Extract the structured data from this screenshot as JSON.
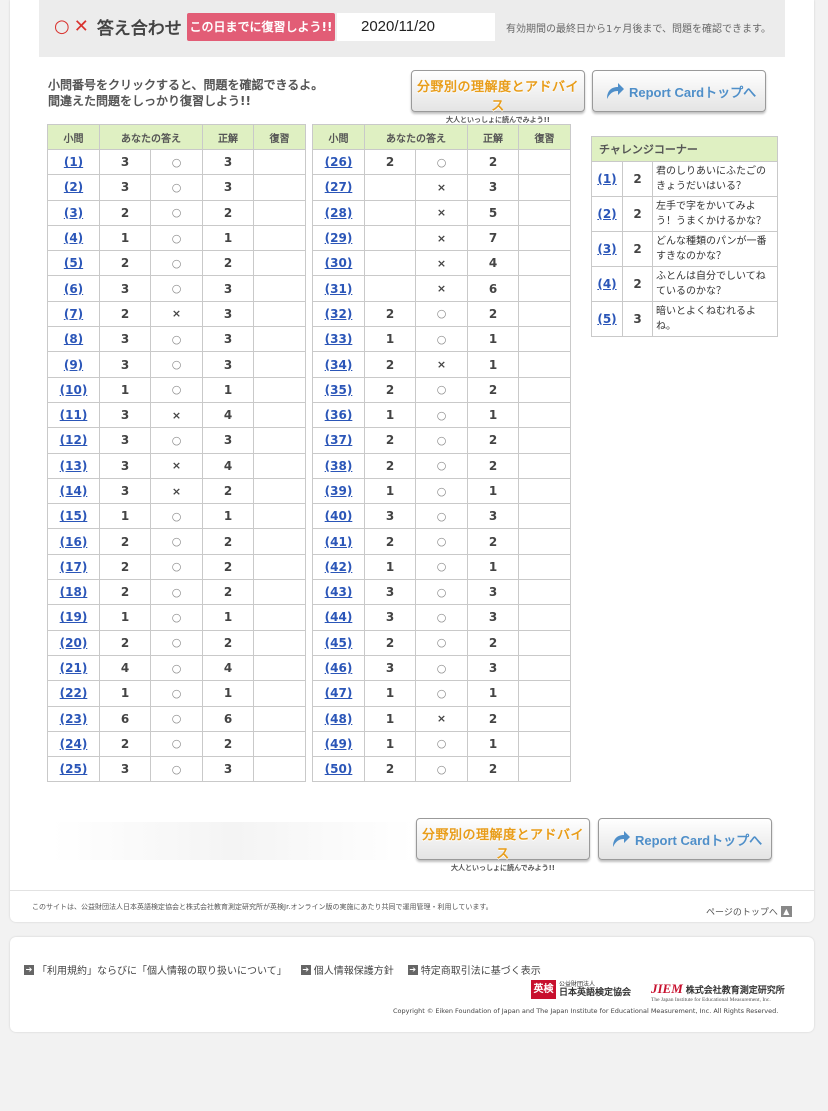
{
  "header": {
    "ox_o": "○",
    "ox_x": "✕",
    "title": "答え合わせ",
    "deadline_badge": "この日までに復習しよう!!",
    "deadline_date": "2020/11/20",
    "deadline_note": "有効期間の最終日から1ヶ月後まで、問題を確認できます。"
  },
  "intro": {
    "line1": "小問番号をクリックすると、問題を確認できるよ。",
    "line2": "間違えた問題をしっかり復習しよう!!"
  },
  "buttons": {
    "advice_main": "分野別の理解度とアドバイス",
    "advice_sub": "大人といっしょに読んでみよう!!",
    "report_label": "Report Cardトップへ"
  },
  "table_headers": {
    "question": "小問",
    "your_answer": "あなたの答え",
    "correct": "正解",
    "review": "復習"
  },
  "results_left": [
    {
      "q": "(1)",
      "ans": "3",
      "mark": "○",
      "correct": "3"
    },
    {
      "q": "(2)",
      "ans": "3",
      "mark": "○",
      "correct": "3"
    },
    {
      "q": "(3)",
      "ans": "2",
      "mark": "○",
      "correct": "2"
    },
    {
      "q": "(4)",
      "ans": "1",
      "mark": "○",
      "correct": "1"
    },
    {
      "q": "(5)",
      "ans": "2",
      "mark": "○",
      "correct": "2"
    },
    {
      "q": "(6)",
      "ans": "3",
      "mark": "○",
      "correct": "3"
    },
    {
      "q": "(7)",
      "ans": "2",
      "mark": "×",
      "correct": "3"
    },
    {
      "q": "(8)",
      "ans": "3",
      "mark": "○",
      "correct": "3"
    },
    {
      "q": "(9)",
      "ans": "3",
      "mark": "○",
      "correct": "3"
    },
    {
      "q": "(10)",
      "ans": "1",
      "mark": "○",
      "correct": "1"
    },
    {
      "q": "(11)",
      "ans": "3",
      "mark": "×",
      "correct": "4"
    },
    {
      "q": "(12)",
      "ans": "3",
      "mark": "○",
      "correct": "3"
    },
    {
      "q": "(13)",
      "ans": "3",
      "mark": "×",
      "correct": "4"
    },
    {
      "q": "(14)",
      "ans": "3",
      "mark": "×",
      "correct": "2"
    },
    {
      "q": "(15)",
      "ans": "1",
      "mark": "○",
      "correct": "1"
    },
    {
      "q": "(16)",
      "ans": "2",
      "mark": "○",
      "correct": "2"
    },
    {
      "q": "(17)",
      "ans": "2",
      "mark": "○",
      "correct": "2"
    },
    {
      "q": "(18)",
      "ans": "2",
      "mark": "○",
      "correct": "2"
    },
    {
      "q": "(19)",
      "ans": "1",
      "mark": "○",
      "correct": "1"
    },
    {
      "q": "(20)",
      "ans": "2",
      "mark": "○",
      "correct": "2"
    },
    {
      "q": "(21)",
      "ans": "4",
      "mark": "○",
      "correct": "4"
    },
    {
      "q": "(22)",
      "ans": "1",
      "mark": "○",
      "correct": "1"
    },
    {
      "q": "(23)",
      "ans": "6",
      "mark": "○",
      "correct": "6"
    },
    {
      "q": "(24)",
      "ans": "2",
      "mark": "○",
      "correct": "2"
    },
    {
      "q": "(25)",
      "ans": "3",
      "mark": "○",
      "correct": "3"
    }
  ],
  "results_right": [
    {
      "q": "(26)",
      "ans": "2",
      "mark": "○",
      "correct": "2"
    },
    {
      "q": "(27)",
      "ans": "",
      "mark": "×",
      "correct": "3"
    },
    {
      "q": "(28)",
      "ans": "",
      "mark": "×",
      "correct": "5"
    },
    {
      "q": "(29)",
      "ans": "",
      "mark": "×",
      "correct": "7"
    },
    {
      "q": "(30)",
      "ans": "",
      "mark": "×",
      "correct": "4"
    },
    {
      "q": "(31)",
      "ans": "",
      "mark": "×",
      "correct": "6"
    },
    {
      "q": "(32)",
      "ans": "2",
      "mark": "○",
      "correct": "2"
    },
    {
      "q": "(33)",
      "ans": "1",
      "mark": "○",
      "correct": "1"
    },
    {
      "q": "(34)",
      "ans": "2",
      "mark": "×",
      "correct": "1"
    },
    {
      "q": "(35)",
      "ans": "2",
      "mark": "○",
      "correct": "2"
    },
    {
      "q": "(36)",
      "ans": "1",
      "mark": "○",
      "correct": "1"
    },
    {
      "q": "(37)",
      "ans": "2",
      "mark": "○",
      "correct": "2"
    },
    {
      "q": "(38)",
      "ans": "2",
      "mark": "○",
      "correct": "2"
    },
    {
      "q": "(39)",
      "ans": "1",
      "mark": "○",
      "correct": "1"
    },
    {
      "q": "(40)",
      "ans": "3",
      "mark": "○",
      "correct": "3"
    },
    {
      "q": "(41)",
      "ans": "2",
      "mark": "○",
      "correct": "2"
    },
    {
      "q": "(42)",
      "ans": "1",
      "mark": "○",
      "correct": "1"
    },
    {
      "q": "(43)",
      "ans": "3",
      "mark": "○",
      "correct": "3"
    },
    {
      "q": "(44)",
      "ans": "3",
      "mark": "○",
      "correct": "3"
    },
    {
      "q": "(45)",
      "ans": "2",
      "mark": "○",
      "correct": "2"
    },
    {
      "q": "(46)",
      "ans": "3",
      "mark": "○",
      "correct": "3"
    },
    {
      "q": "(47)",
      "ans": "1",
      "mark": "○",
      "correct": "1"
    },
    {
      "q": "(48)",
      "ans": "1",
      "mark": "×",
      "correct": "2"
    },
    {
      "q": "(49)",
      "ans": "1",
      "mark": "○",
      "correct": "1"
    },
    {
      "q": "(50)",
      "ans": "2",
      "mark": "○",
      "correct": "2"
    }
  ],
  "challenge": {
    "title": "チャレンジコーナー",
    "items": [
      {
        "q": "(1)",
        "ans": "2",
        "text": "君のしりあいにふたごのきょうだいはいる？"
      },
      {
        "q": "(2)",
        "ans": "2",
        "text": "左手で字をかいてみよう！うまくかけるかな？"
      },
      {
        "q": "(3)",
        "ans": "2",
        "text": "どんな種類のパンが一番すきなのかな？"
      },
      {
        "q": "(4)",
        "ans": "2",
        "text": "ふとんは自分でしいてねているのかな？"
      },
      {
        "q": "(5)",
        "ans": "3",
        "text": "暗いとよくねむれるよね。"
      }
    ]
  },
  "footer": {
    "site_note": "このサイトは、公益財団法人日本英語検定協会と株式会社教育測定研究所が英検Jr.オンライン版の実施にあたり共同で運用管理・利用しています。",
    "page_top": "ページのトップへ",
    "links": [
      "「利用規約」ならびに「個人情報の取り扱いについて」",
      "個人情報保護方針",
      "特定商取引法に基づく表示"
    ],
    "eiken_mark": "英検",
    "eiken_sub": "公益財団法人",
    "eiken_name": "日本英語検定協会",
    "jiem_mark": "JIEM",
    "jiem_name": "株式会社教育測定研究所",
    "jiem_en": "The Japan Institute for Educational Measurement, Inc.",
    "copyright": "Copyright © Eiken Foundation of Japan and The Japan Institute for Educational Measurement, Inc. All Rights Reserved."
  }
}
